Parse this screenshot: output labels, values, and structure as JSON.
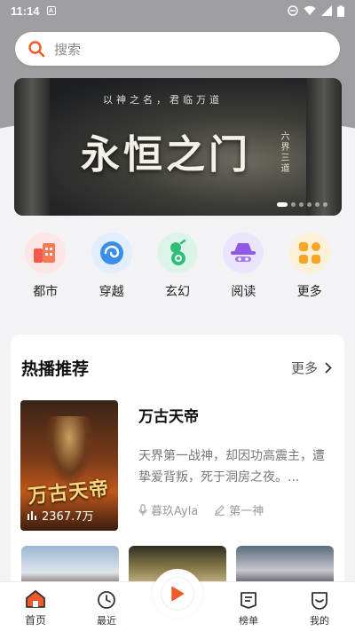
{
  "status_bar": {
    "time": "11:14"
  },
  "search": {
    "placeholder": "搜索"
  },
  "banner": {
    "tagline": "以神之名，君临万道",
    "title": "永恒之门",
    "side_text": "六界三道"
  },
  "categories": [
    {
      "label": "都市",
      "icon": "city-icon",
      "color": "#f25a4a"
    },
    {
      "label": "穿越",
      "icon": "swirl-icon",
      "color": "#3a8ee8"
    },
    {
      "label": "玄幻",
      "icon": "gourd-icon",
      "color": "#2fbe7a"
    },
    {
      "label": "阅读",
      "icon": "hat-mask-icon",
      "color": "#8f5ae8"
    },
    {
      "label": "更多",
      "icon": "grid-more-icon",
      "color": "#f5a623"
    }
  ],
  "section": {
    "title": "热播推荐",
    "more_label": "更多"
  },
  "featured_book": {
    "cover_title": "万古天帝",
    "play_count": "2367.7万",
    "name": "万古天帝",
    "description": "天界第一战神，却因功高震主，遭挚爱背叛，死于洞房之夜。...",
    "narrator": "暮玖Ayla",
    "chapter": "第一神"
  },
  "tabbar": {
    "home": "首页",
    "recent": "最近",
    "ranking": "榜单",
    "mine": "我的"
  },
  "colors": {
    "accent": "#f05a28"
  }
}
